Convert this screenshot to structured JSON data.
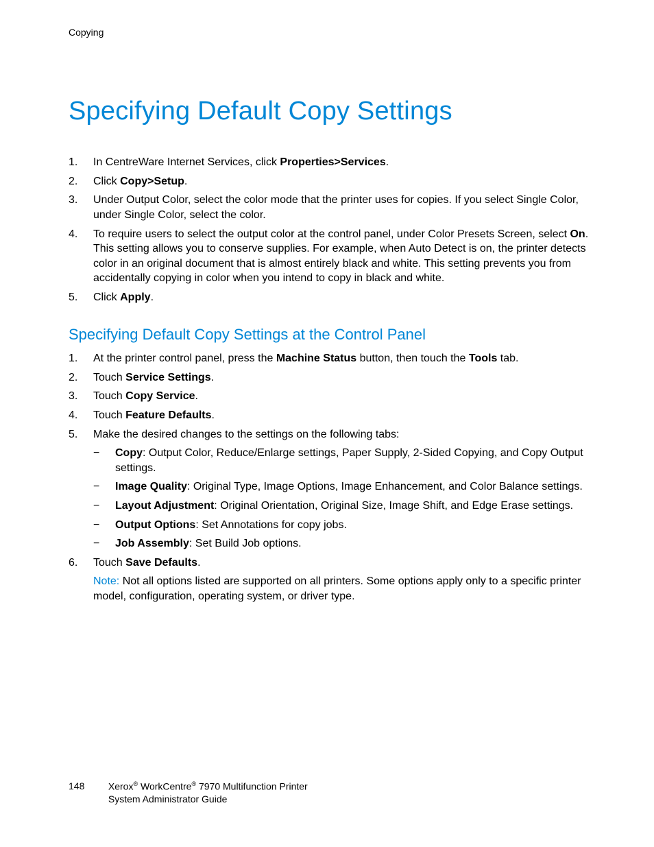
{
  "header": {
    "section": "Copying"
  },
  "title": "Specifying Default Copy Settings",
  "list1": {
    "i1_pre": "In CentreWare Internet Services, click ",
    "i1_b": "Properties>Services",
    "i1_post": ".",
    "i2_pre": "Click ",
    "i2_b": "Copy>Setup",
    "i2_post": ".",
    "i3": "Under Output Color, select the color mode that the printer uses for copies. If you select Single Color, under Single Color, select the color.",
    "i4_pre": "To require users to select the output color at the control panel, under Color Presets Screen, select ",
    "i4_b": "On",
    "i4_post": ". This setting allows you to conserve supplies. For example, when Auto Detect is on, the printer detects color in an original document that is almost entirely black and white. This setting prevents you from accidentally copying in color when you intend to copy in black and white.",
    "i5_pre": "Click ",
    "i5_b": "Apply",
    "i5_post": "."
  },
  "subtitle": "Specifying Default Copy Settings at the Control Panel",
  "list2": {
    "i1_pre": "At the printer control panel, press the ",
    "i1_b1": "Machine Status",
    "i1_mid": " button, then touch the ",
    "i1_b2": "Tools",
    "i1_post": " tab.",
    "i2_pre": "Touch ",
    "i2_b": "Service Settings",
    "i2_post": ".",
    "i3_pre": "Touch ",
    "i3_b": "Copy Service",
    "i3_post": ".",
    "i4_pre": "Touch ",
    "i4_b": "Feature Defaults",
    "i4_post": ".",
    "i5": "Make the desired changes to the settings on the following tabs:",
    "sub": {
      "a_b": "Copy",
      "a_t": ": Output Color, Reduce/Enlarge settings, Paper Supply, 2-Sided Copying, and Copy Output settings.",
      "b_b": "Image Quality",
      "b_t": ": Original Type, Image Options, Image Enhancement, and Color Balance settings.",
      "c_b": "Layout Adjustment",
      "c_t": ": Original Orientation, Original Size, Image Shift, and Edge Erase settings.",
      "d_b": "Output Options",
      "d_t": ": Set Annotations for copy jobs.",
      "e_b": "Job Assembly",
      "e_t": ": Set Build Job options."
    },
    "i6_pre": "Touch ",
    "i6_b": "Save Defaults",
    "i6_post": ".",
    "note_label": "Note:",
    "note_text": " Not all options listed are supported on all printers. Some options apply only to a specific printer model, configuration, operating system, or driver type."
  },
  "footer": {
    "page": "148",
    "brand1": "Xerox",
    "trademark": "®",
    "brand2": " WorkCentre",
    "product_tail": " 7970 Multifunction Printer",
    "line2": "System Administrator Guide"
  }
}
